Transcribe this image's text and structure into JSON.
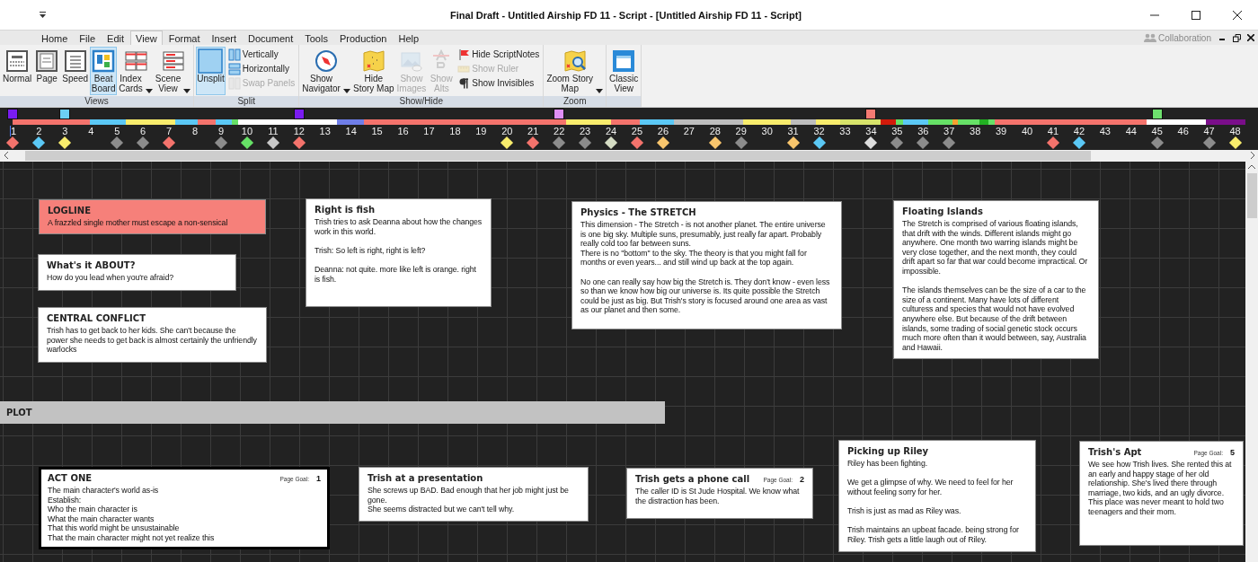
{
  "window": {
    "title": "Final Draft - Untitled Airship FD 11 - Script - [Untitled Airship FD 11 - Script]"
  },
  "menu": [
    {
      "label": "Home",
      "selected": false
    },
    {
      "label": "File",
      "selected": false
    },
    {
      "label": "Edit",
      "selected": false
    },
    {
      "label": "View",
      "selected": true
    },
    {
      "label": "Format",
      "selected": false
    },
    {
      "label": "Insert",
      "selected": false
    },
    {
      "label": "Document",
      "selected": false
    },
    {
      "label": "Tools",
      "selected": false
    },
    {
      "label": "Production",
      "selected": false
    },
    {
      "label": "Help",
      "selected": false
    }
  ],
  "collaboration": {
    "label": "Collaboration"
  },
  "ribbon": [
    {
      "label": "Views",
      "buttons": [
        {
          "label": "Normal",
          "kind": "large"
        },
        {
          "label": "Page",
          "kind": "large"
        },
        {
          "label": "Speed",
          "kind": "large"
        },
        {
          "label": "Beat\nBoard",
          "kind": "large",
          "on": true
        },
        {
          "label": "Index\nCards",
          "kind": "large",
          "dropdown": true
        },
        {
          "label": "Scene\nView",
          "kind": "large",
          "dropdown": true
        }
      ]
    },
    {
      "label": "Split",
      "buttons": [
        {
          "label": "Unsplit",
          "kind": "large",
          "on": true
        },
        {
          "label": "Vertically",
          "kind": "small"
        },
        {
          "label": "Horizontally",
          "kind": "small"
        },
        {
          "label": "Swap Panels",
          "kind": "small",
          "disabled": true
        }
      ]
    },
    {
      "label": "Show/Hide",
      "buttons": [
        {
          "label": "Show\nNavigator",
          "kind": "large",
          "dropdown": true
        },
        {
          "label": "Hide\nStory Map",
          "kind": "large"
        },
        {
          "label": "Show\nImages",
          "kind": "large",
          "disabled": true
        },
        {
          "label": "Show\nAlts",
          "kind": "large",
          "disabled": true
        },
        {
          "label": "Hide ScriptNotes",
          "kind": "small"
        },
        {
          "label": "Show Ruler",
          "kind": "small",
          "disabled": true
        },
        {
          "label": "Show Invisibles",
          "kind": "small"
        }
      ]
    },
    {
      "label": "Zoom",
      "buttons": [
        {
          "label": "Zoom Story\nMap",
          "kind": "large",
          "dropdown": true
        }
      ]
    },
    {
      "buttons": [
        {
          "label": "Classic\nView",
          "kind": "large"
        }
      ]
    }
  ],
  "timeline": {
    "scenes": [
      {
        "number": "1",
        "selected": true,
        "color": "#f4736c",
        "marker": {
          "color": "#7a1cf0"
        }
      },
      {
        "number": "2",
        "selected": false,
        "color": "#5bc8f5"
      },
      {
        "number": "3",
        "selected": false,
        "color": "#f8ec6c",
        "marker": {
          "color": "#6cd0f5"
        }
      },
      {
        "number": "4",
        "selected": false
      },
      {
        "number": "5",
        "selected": false,
        "color": "#8c8c8c"
      },
      {
        "number": "6",
        "selected": false,
        "color": "#8c8c8c"
      },
      {
        "number": "7",
        "selected": false,
        "color": "#f4736c"
      },
      {
        "number": "8",
        "selected": false
      },
      {
        "number": "9",
        "selected": false,
        "color": "#8c8c8c"
      },
      {
        "number": "10",
        "selected": false,
        "color": "#66e066"
      },
      {
        "number": "11",
        "selected": false,
        "color": "#c8c8c8"
      },
      {
        "number": "12",
        "selected": false,
        "color": "#f4736c",
        "marker": {
          "color": "#7a1cf0"
        }
      },
      {
        "number": "13",
        "selected": false
      },
      {
        "number": "14",
        "selected": false
      },
      {
        "number": "15",
        "selected": false
      },
      {
        "number": "16",
        "selected": false
      },
      {
        "number": "17",
        "selected": false
      },
      {
        "number": "18",
        "selected": false
      },
      {
        "number": "19",
        "selected": false
      },
      {
        "number": "20",
        "selected": false,
        "color": "#f8ec6c"
      },
      {
        "number": "21",
        "selected": false,
        "color": "#f4736c"
      },
      {
        "number": "22",
        "selected": false,
        "color": "#8c8c8c",
        "marker": {
          "color": "#e08ef5"
        }
      },
      {
        "number": "23",
        "selected": false,
        "color": "#8c8c8c"
      },
      {
        "number": "24",
        "selected": false,
        "color": "#d5dcc4"
      },
      {
        "number": "25",
        "selected": false,
        "color": "#f4736c"
      },
      {
        "number": "26",
        "selected": false,
        "color": "#f8c56c"
      },
      {
        "number": "27",
        "selected": false
      },
      {
        "number": "28",
        "selected": false,
        "color": "#f8c56c"
      },
      {
        "number": "29",
        "selected": false,
        "color": "#8c8c8c"
      },
      {
        "number": "30",
        "selected": false
      },
      {
        "number": "31",
        "selected": false,
        "color": "#f8c56c"
      },
      {
        "number": "32",
        "selected": false,
        "color": "#5bc8f5"
      },
      {
        "number": "33",
        "selected": false
      },
      {
        "number": "34",
        "selected": false,
        "color": "#dddddd",
        "marker": {
          "color": "#f47a72"
        }
      },
      {
        "number": "35",
        "selected": false,
        "color": "#8c8c8c"
      },
      {
        "number": "36",
        "selected": false,
        "color": "#8c8c8c"
      },
      {
        "number": "37",
        "selected": false,
        "color": "#8c8c8c"
      },
      {
        "number": "38",
        "selected": false
      },
      {
        "number": "39",
        "selected": false
      },
      {
        "number": "40",
        "selected": false
      },
      {
        "number": "41",
        "selected": false,
        "color": "#f4736c"
      },
      {
        "number": "42",
        "selected": false,
        "color": "#5bc8f5"
      },
      {
        "number": "43",
        "selected": false
      },
      {
        "number": "44",
        "selected": false
      },
      {
        "number": "45",
        "selected": false,
        "color": "#8c8c8c",
        "marker": {
          "color": "#6ee06e"
        }
      },
      {
        "number": "46",
        "selected": false
      },
      {
        "number": "47",
        "selected": false,
        "color": "#8c8c8c"
      },
      {
        "number": "48",
        "selected": false,
        "color": "#f8ec6c"
      }
    ]
  },
  "board": {
    "cards": [
      {
        "title": "LOGLINE",
        "body": "A frazzled single mother must escape a non-sensical",
        "color": "#f6807a"
      },
      {
        "title": "What's it ABOUT?",
        "body": "How do you lead when you're afraid?",
        "color": "#ffffff"
      },
      {
        "title": "CENTRAL CONFLICT",
        "body": "Trish has to get back to her kids. She can't because the power she needs to get back is almost certainly the unfriendly warlocks",
        "color": "#ffffff"
      },
      {
        "title": "Right is fish",
        "body": "Trish tries to ask Deanna about how the changes work in this world.\n\nTrish: So left is right, right is left?\n\nDeanna: not quite. more like left is orange. right is fish.",
        "color": "#ffffff"
      },
      {
        "title": "Physics - The STRETCH",
        "body": "This dimension - The Stretch - is not another planet. The entire universe is one big sky. Multiple suns, presumably, just really far apart. Probably really cold too far between suns.\nThere is no \"bottom\" to the sky. The theory is that you might fall for months or even years... and still wind up back at the top again.\n\nNo one can really say how big the Stretch is. They don't know - even less so than we know how big our universe is. Its quite possible the Stretch could be just as big. But Trish's story is focused around one area as vast as our planet and then some.",
        "color": "#ffffff"
      },
      {
        "title": "Floating Islands",
        "body": "The Stretch is comprised of various floating islands, that drift with the winds. Different islands might go anywhere. One month two warring islands might be very close together, and the next month, they could drift apart so far that war could become impractical. Or impossible.\n\nThe islands themselves can be the size of a car to the size of a continent. Many have lots of different culturess and species that would not have evolved anywhere else. But because of the drift between islands, some trading of social genetic stock occurs much more often than it would between, say, Australia and Hawaii.",
        "color": "#ffffff"
      }
    ],
    "band": {
      "label": "PLOT"
    },
    "plot_cards": [
      {
        "title": "ACT ONE",
        "page_goal_label": "Page Goal:",
        "page_goal": "1",
        "kind": "act",
        "body": "The main character's world as-is\nEstablish:\nWho the main character is\nWhat the main character wants\nThat this world might be unsustainable\nThat the main character might not yet realize this"
      },
      {
        "title": "Trish at a presentation",
        "kind": "scene",
        "body": "She screws up BAD. Bad enough that her job might just be gone.\nShe seems distracted but we can't tell why."
      },
      {
        "title": "Trish gets a phone call",
        "page_goal_label": "Page Goal:",
        "page_goal": "2",
        "kind": "scene",
        "body": "The caller ID is St Jude Hospital. We know what the distraction has been."
      },
      {
        "title": "Picking up Riley",
        "kind": "scene",
        "body": "Riley has been fighting.\n\nWe get a glimpse of why. We need to feel for her without feeling sorry for her.\n\nTrish is just as mad as Riley was.\n\nTrish maintains an upbeat facade. being strong for Riley. Trish gets a little laugh out of Riley."
      },
      {
        "title": "Trish's Apt",
        "page_goal_label": "Page Goal:",
        "page_goal": "5",
        "kind": "scene",
        "body": "We see how Trish lives. She rented this at an early and happy stage of her old relationship. She's lived there through marriage, two kids, and an ugly divorce. This place was never meant to hold two teenagers and their mom."
      }
    ]
  }
}
